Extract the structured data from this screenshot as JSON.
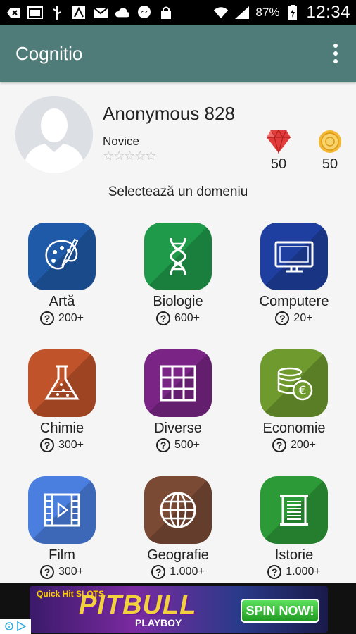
{
  "status_bar": {
    "battery": "87%",
    "time": "12:34"
  },
  "app_bar": {
    "title": "Cognitio"
  },
  "profile": {
    "name": "Anonymous 828",
    "level": "Novice",
    "stars_filled": 0,
    "stars_total": 5,
    "stars_text": "☆☆☆☆☆",
    "gems": "50",
    "coins": "50"
  },
  "prompt": "Selectează un domeniu",
  "categories": [
    {
      "name": "Artă",
      "count": "200+",
      "color": "#1f5aa8",
      "icon": "palette-icon"
    },
    {
      "name": "Biologie",
      "count": "600+",
      "color": "#1f9a4a",
      "icon": "dna-icon"
    },
    {
      "name": "Computere",
      "count": "20+",
      "color": "#1e3fa0",
      "icon": "monitor-icon"
    },
    {
      "name": "Chimie",
      "count": "300+",
      "color": "#c0532a",
      "icon": "flask-icon"
    },
    {
      "name": "Diverse",
      "count": "500+",
      "color": "#7a2486",
      "icon": "grid-icon"
    },
    {
      "name": "Economie",
      "count": "200+",
      "color": "#6e9a2e",
      "icon": "coins-icon"
    },
    {
      "name": "Film",
      "count": "300+",
      "color": "#4a7fe0",
      "icon": "film-icon"
    },
    {
      "name": "Geografie",
      "count": "1.000+",
      "color": "#7a4a35",
      "icon": "globe-icon"
    },
    {
      "name": "Istorie",
      "count": "1.000+",
      "color": "#2d9a38",
      "icon": "scroll-icon"
    }
  ],
  "ad": {
    "brand": "Quick Hit SLOTS",
    "title": "PITBULL",
    "subtitle": "PLAYBOY",
    "cta": "SPIN NOW!"
  }
}
